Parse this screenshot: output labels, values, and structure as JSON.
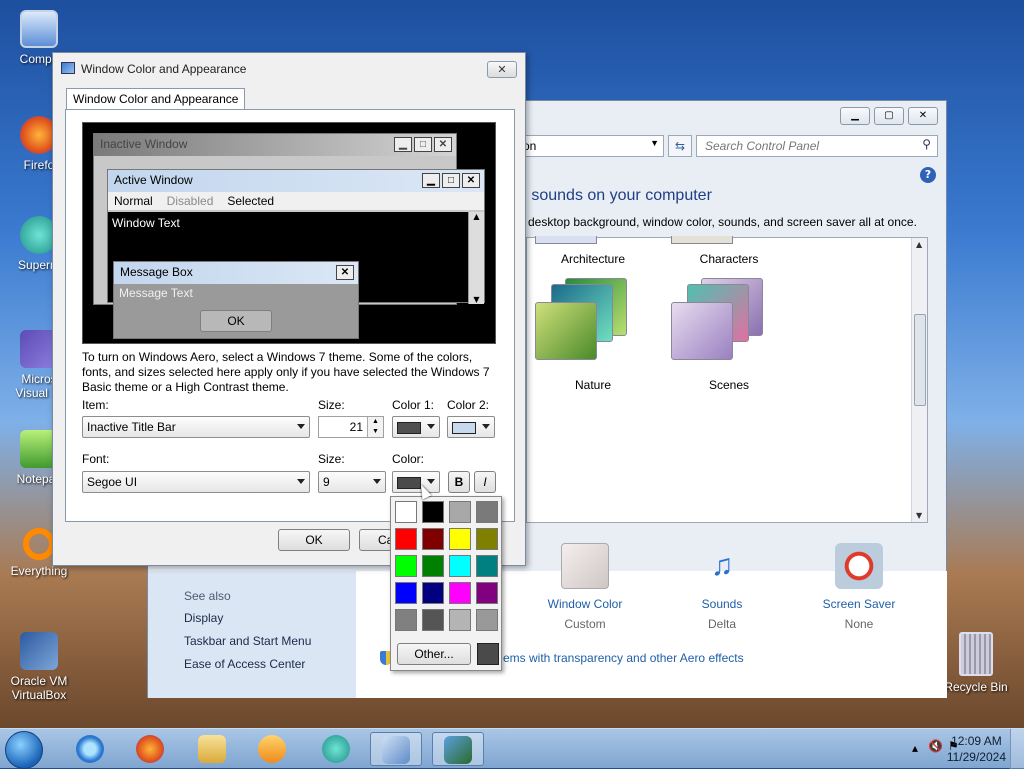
{
  "desktop": {
    "icons": [
      {
        "label": "Compu"
      },
      {
        "label": "Firefo"
      },
      {
        "label": "Superm"
      },
      {
        "label": "Micros Visual St"
      },
      {
        "label": "Notepac"
      },
      {
        "label": "Everything"
      },
      {
        "label": "Oracle VM VirtualBox"
      }
    ],
    "recycle_bin": "Recycle Bin"
  },
  "control_panel": {
    "address_partial": "on",
    "search_placeholder": "Search Control Panel",
    "heading": "d sounds on your computer",
    "subheading": "desktop background, window color, sounds, and screen saver all at once.",
    "themes": [
      "Architecture",
      "Characters",
      "Nature",
      "Scenes"
    ],
    "see_also": "See also",
    "links": [
      "Display",
      "Taskbar and Start Menu",
      "Ease of Access Center"
    ],
    "bottom_items": [
      {
        "title": "Window Color",
        "value": "Custom"
      },
      {
        "title": "Sounds",
        "value": "Delta"
      },
      {
        "title": "Screen Saver",
        "value": "None"
      }
    ],
    "aero_link": "ems with transparency and other Aero effects"
  },
  "dialog": {
    "title": "Window Color and Appearance",
    "tab": "Window Color and Appearance",
    "preview": {
      "inactive_title": "Inactive Window",
      "active_title": "Active Window",
      "menu": [
        "Normal",
        "Disabled",
        "Selected"
      ],
      "window_text": "Window Text",
      "msgbox_title": "Message Box",
      "msgbox_text": "Message Text",
      "ok": "OK"
    },
    "description": "To turn on Windows Aero, select a Windows 7 theme.  Some of the colors, fonts, and sizes selected here apply only if you have selected the Windows 7 Basic theme or a High Contrast theme.",
    "labels": {
      "item": "Item:",
      "size1": "Size:",
      "color1": "Color 1:",
      "color2": "Color 2:",
      "font": "Font:",
      "size2": "Size:",
      "color": "Color:"
    },
    "item_value": "Inactive Title Bar",
    "item_size": "21",
    "font_value": "Segoe UI",
    "font_size": "9",
    "bold": "B",
    "italic": "I",
    "ok_button": "OK",
    "cancel_button": "Ca",
    "colors": {
      "color1": "#505050",
      "color2": "#c7d9ef",
      "font_color": "#4a4a4a"
    },
    "picker": {
      "palette": [
        "#ffffff",
        "#000000",
        "#a8a8a8",
        "#7a7a7a",
        "#ff0000",
        "#800000",
        "#ffff00",
        "#808000",
        "#00ff00",
        "#008000",
        "#00ffff",
        "#008080",
        "#0000ff",
        "#000080",
        "#ff00ff",
        "#800080",
        "#808080",
        "#555555",
        "#b4b4b4",
        "#999999"
      ],
      "other": "Other...",
      "selected_color": "#4a4a4a"
    }
  },
  "taskbar": {
    "clock_time": "12:09 AM",
    "clock_date": "11/29/2024"
  }
}
